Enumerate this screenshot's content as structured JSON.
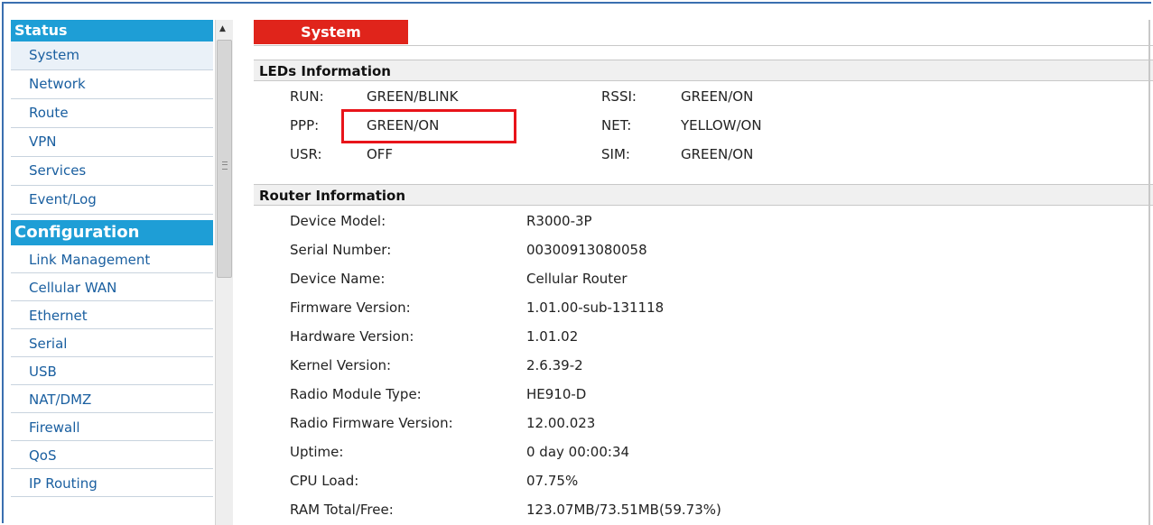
{
  "sidebar": {
    "status_header": "Status",
    "status_items": [
      {
        "label": "System"
      },
      {
        "label": "Network"
      },
      {
        "label": "Route"
      },
      {
        "label": "VPN"
      },
      {
        "label": "Services"
      },
      {
        "label": "Event/Log"
      }
    ],
    "config_header": "Configuration",
    "config_items": [
      {
        "label": "Link Management"
      },
      {
        "label": "Cellular WAN"
      },
      {
        "label": "Ethernet"
      },
      {
        "label": "Serial"
      },
      {
        "label": "USB"
      },
      {
        "label": "NAT/DMZ"
      },
      {
        "label": "Firewall"
      },
      {
        "label": "QoS"
      },
      {
        "label": "IP Routing"
      }
    ]
  },
  "main": {
    "title": "System",
    "leds": {
      "header": "LEDs Information",
      "rows": [
        {
          "k1": "RUN:",
          "v1": "GREEN/BLINK",
          "k2": "RSSI:",
          "v2": "GREEN/ON"
        },
        {
          "k1": "PPP:",
          "v1": "GREEN/ON",
          "k2": "NET:",
          "v2": "YELLOW/ON"
        },
        {
          "k1": "USR:",
          "v1": "OFF",
          "k2": "SIM:",
          "v2": "GREEN/ON"
        }
      ]
    },
    "router": {
      "header": "Router Information",
      "rows": [
        {
          "key": "Device Model:",
          "value": "R3000-3P"
        },
        {
          "key": "Serial Number:",
          "value": "00300913080058"
        },
        {
          "key": "Device Name:",
          "value": "Cellular Router"
        },
        {
          "key": "Firmware Version:",
          "value": "1.01.00-sub-131118"
        },
        {
          "key": "Hardware Version:",
          "value": "1.01.02"
        },
        {
          "key": "Kernel Version:",
          "value": "2.6.39-2"
        },
        {
          "key": "Radio Module Type:",
          "value": "HE910-D"
        },
        {
          "key": "Radio Firmware Version:",
          "value": "12.00.023"
        },
        {
          "key": "Uptime:",
          "value": "0 day 00:00:34"
        },
        {
          "key": "CPU Load:",
          "value": "07.75%"
        },
        {
          "key": "RAM Total/Free:",
          "value": "123.07MB/73.51MB(59.73%)"
        }
      ]
    }
  },
  "colors": {
    "accent": "#1e9ed6",
    "title_tab": "#e0241b",
    "highlight": "#e8141a",
    "link": "#1a5fa0"
  },
  "icons": {
    "scroll_up": "triangle-up-icon"
  }
}
